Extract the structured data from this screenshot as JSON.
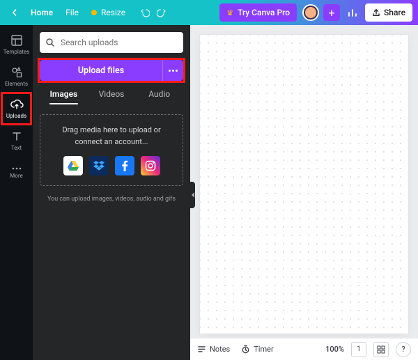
{
  "topbar": {
    "home": "Home",
    "file": "File",
    "resize": "Resize",
    "try_pro": "Try Canva Pro",
    "share": "Share"
  },
  "rail": {
    "templates": "Templates",
    "elements": "Elements",
    "uploads": "Uploads",
    "text": "Text",
    "more": "More"
  },
  "panel": {
    "search_placeholder": "Search uploads",
    "upload_label": "Upload files",
    "tabs": {
      "images": "Images",
      "videos": "Videos",
      "audio": "Audio"
    },
    "drop_line1": "Drag media here to upload or",
    "drop_line2": "connect an account...",
    "hint": "You can upload images, videos, audio and gifs",
    "accounts": {
      "gdrive": "google-drive",
      "dropbox": "dropbox",
      "facebook": "facebook",
      "instagram": "instagram"
    }
  },
  "bottombar": {
    "notes": "Notes",
    "timer": "Timer",
    "zoom": "100%",
    "page_count": "1"
  }
}
